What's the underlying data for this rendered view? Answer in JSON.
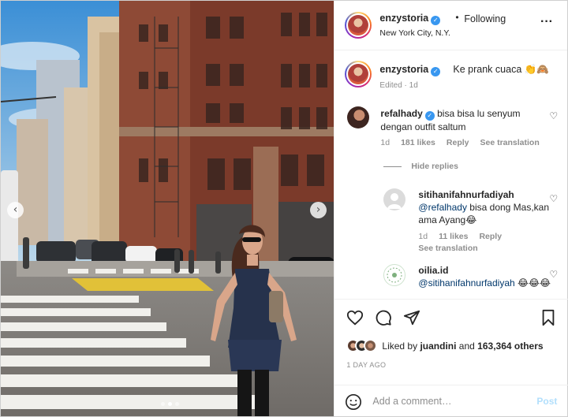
{
  "header": {
    "username": "enzystoria",
    "separator": "•",
    "follow_status": "Following",
    "location": "New York City, N.Y.",
    "more_icon": "more-horizontal-icon"
  },
  "caption": {
    "username": "enzystoria",
    "text": "Ke prank cuaca 👏🙈",
    "meta": "Edited · 1d"
  },
  "comments": [
    {
      "username": "refalhady",
      "verified": true,
      "text": "bisa bisa lu senyum dengan outfit saltum",
      "age": "1d",
      "likes": "181 likes",
      "reply_label": "Reply",
      "translate_label": "See translation",
      "hide_replies_label": "Hide replies"
    }
  ],
  "replies": [
    {
      "username": "sitihanifahnurfadiyah",
      "mention": "@refalhady",
      "text": "bisa dong Mas,kan ama Ayang😂",
      "age": "1d",
      "likes": "11 likes",
      "reply_label": "Reply",
      "translate_label": "See translation"
    },
    {
      "username": "oilia.id",
      "mention": "@sitihanifahnurfadiyah",
      "text": "😂😂😂"
    }
  ],
  "actions": {
    "like_icon": "heart-icon",
    "comment_icon": "comment-icon",
    "share_icon": "send-icon",
    "save_icon": "bookmark-icon",
    "liked_by_prefix": "Liked by",
    "liked_by_user": "juandini",
    "liked_by_and": "and",
    "liked_by_others": "163,364 others",
    "date": "1 DAY AGO"
  },
  "add_comment": {
    "placeholder": "Add a comment…",
    "post_label": "Post",
    "emoji_icon": "emoji-icon"
  },
  "carousel": {
    "prev_icon": "chevron-left-icon",
    "next_icon": "chevron-right-icon",
    "prev_glyph": "‹",
    "next_glyph": "›",
    "slides": 3,
    "active_slide": 2
  },
  "colors": {
    "link": "#00376b",
    "verified": "#3897f0",
    "muted": "#8e8e8e",
    "post_disabled": "#b2dffc"
  }
}
